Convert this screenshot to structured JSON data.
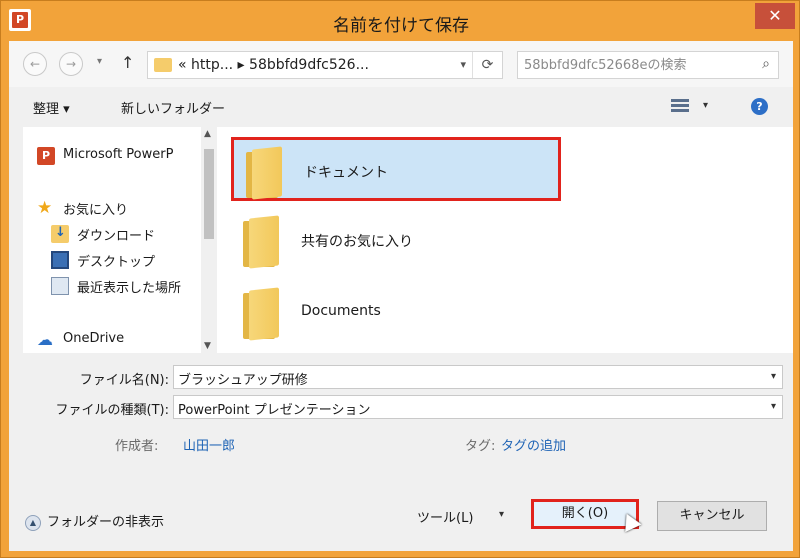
{
  "window": {
    "title": "名前を付けて保存",
    "close_glyph": "✕",
    "app_icon_letter": "P",
    "accent_color": "#f2a33a",
    "highlight_color": "#e1231d"
  },
  "nav": {
    "back_glyph": "←",
    "forward_glyph": "→",
    "up_glyph": "↑",
    "address_path": "« http... ▸ 58bbfd9dfc526...",
    "search_placeholder": "58bbfd9dfc52668eの検索"
  },
  "toolbar": {
    "organize": "整理 ▾",
    "new_folder": "新しいフォルダー",
    "help": "?"
  },
  "sidebar": {
    "items": [
      {
        "label": "Microsoft PowerP",
        "icon": "powerpoint-icon"
      },
      {
        "label": "お気に入り",
        "icon": "star-icon"
      },
      {
        "label": "ダウンロード",
        "icon": "download-folder-icon"
      },
      {
        "label": "デスクトップ",
        "icon": "desktop-icon"
      },
      {
        "label": "最近表示した場所",
        "icon": "recent-places-icon"
      },
      {
        "label": "OneDrive",
        "icon": "cloud-icon"
      }
    ]
  },
  "files": [
    {
      "name": "ドキュメント",
      "selected": true
    },
    {
      "name": "共有のお気に入り",
      "selected": false
    },
    {
      "name": "Documents",
      "selected": false
    }
  ],
  "form": {
    "filename_label": "ファイル名(N):",
    "filename_value": "ブラッシュアップ研修",
    "filetype_label": "ファイルの種類(T):",
    "filetype_value": "PowerPoint プレゼンテーション",
    "author_label": "作成者:",
    "author_value": "山田一郎",
    "tags_label": "タグ:",
    "tags_value": "タグの追加"
  },
  "footer": {
    "hide_folders": "フォルダーの非表示",
    "tools": "ツール(L)",
    "open_button": "開く(O)",
    "cancel_button": "キャンセル"
  }
}
